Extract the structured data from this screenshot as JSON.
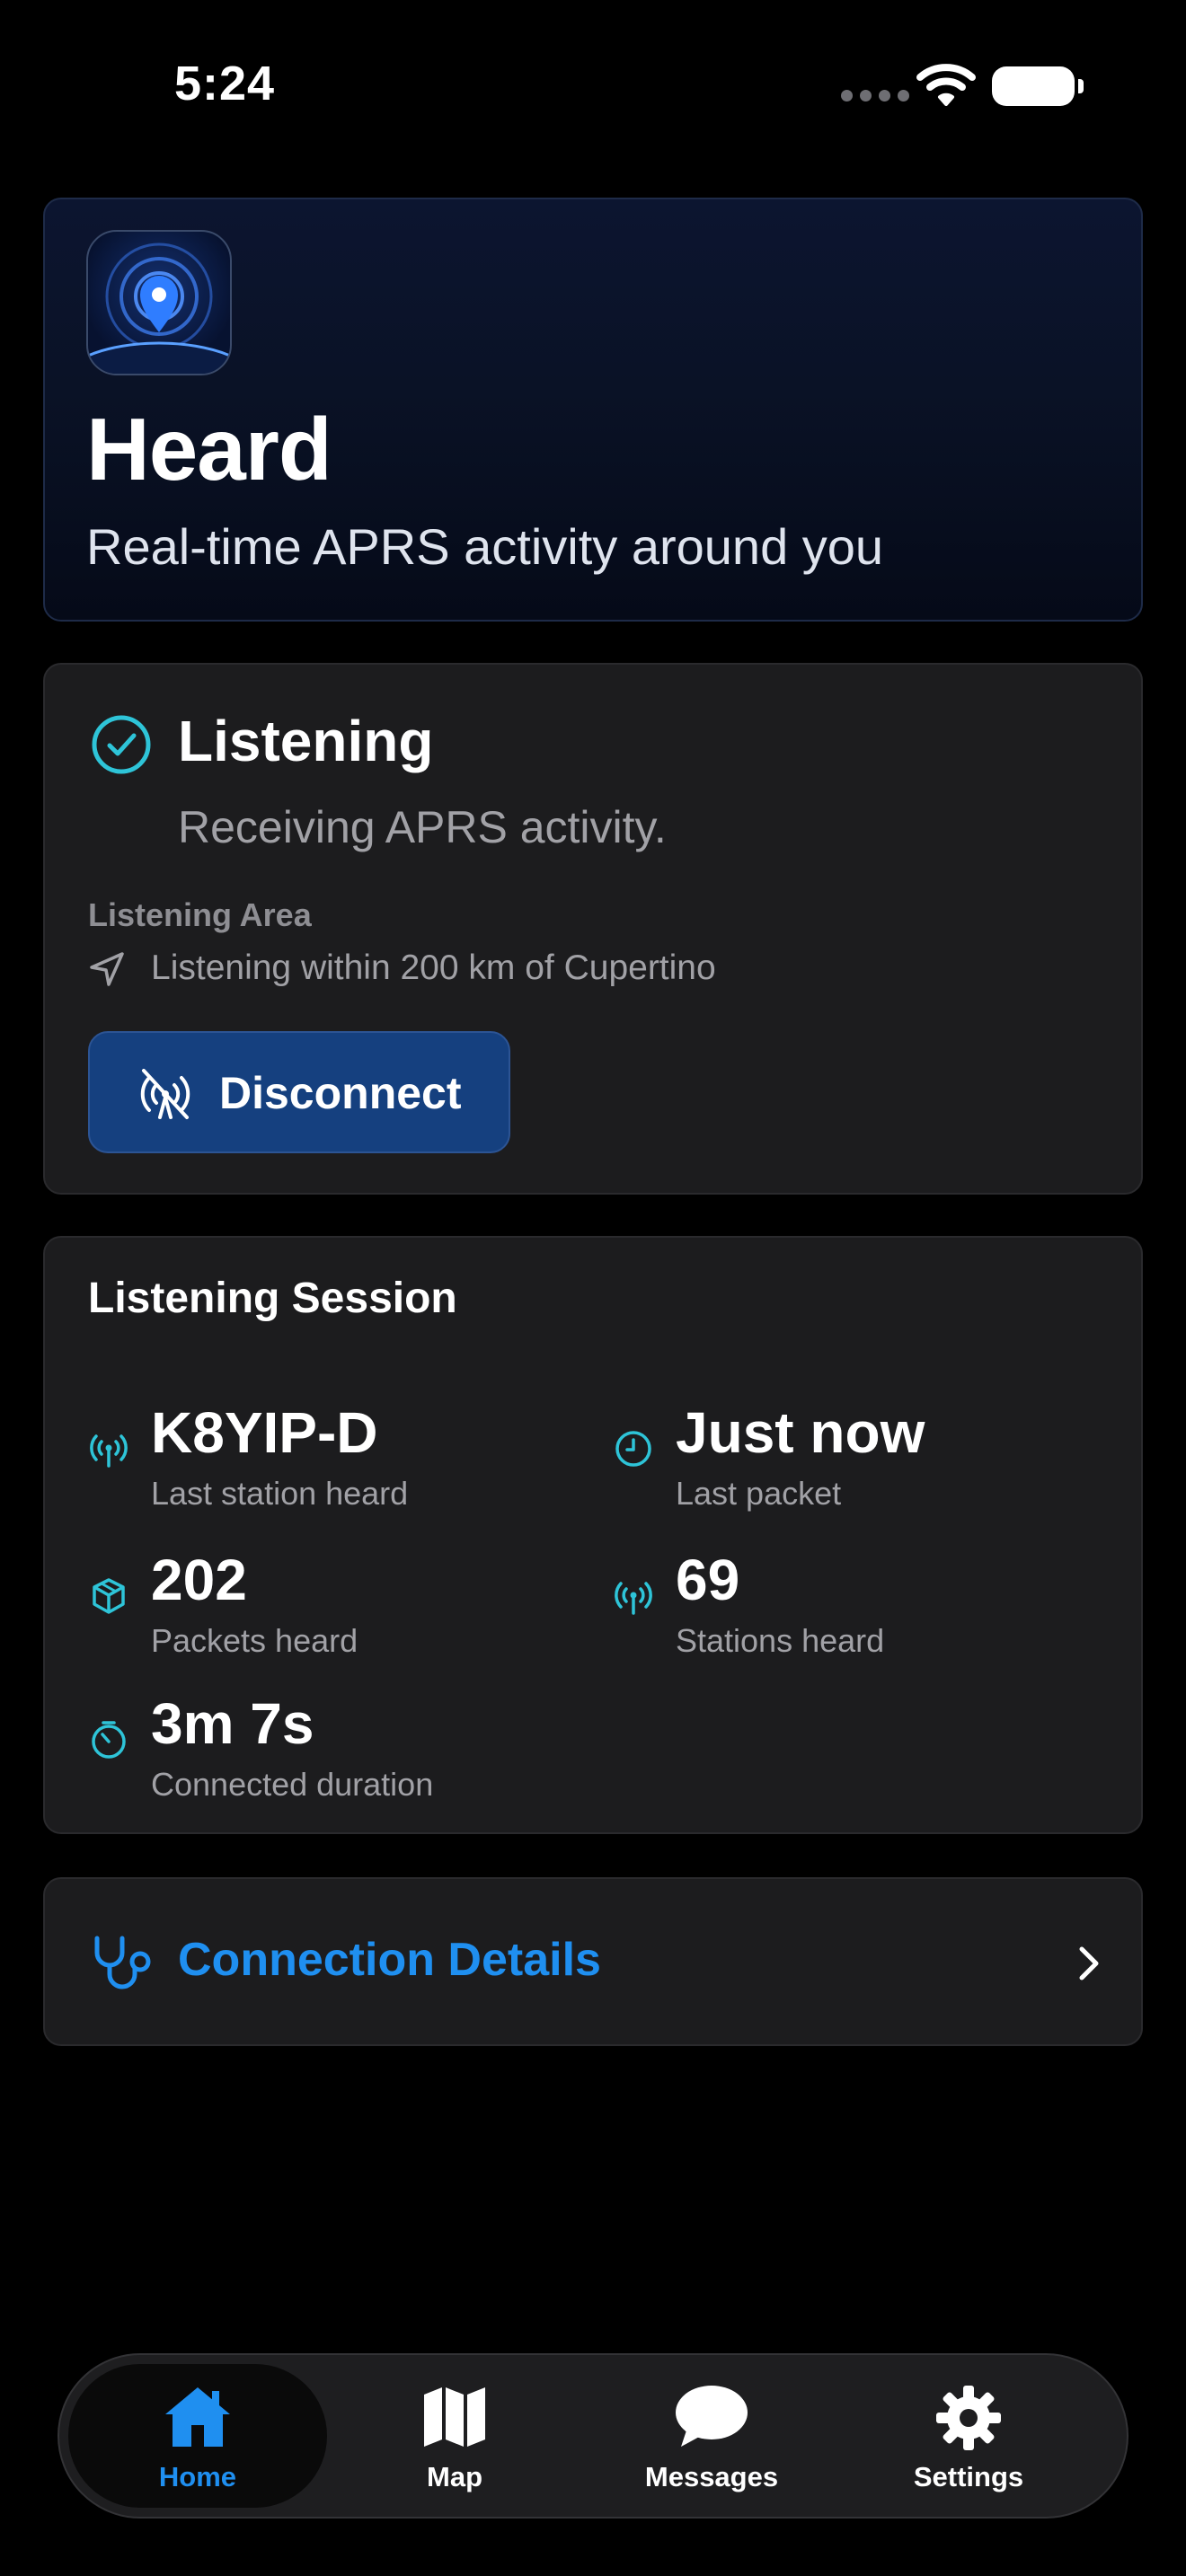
{
  "status_bar": {
    "time": "5:24"
  },
  "hero": {
    "title": "Heard",
    "subtitle": "Real-time APRS activity around you"
  },
  "listening": {
    "title": "Listening",
    "subtitle": "Receiving APRS activity.",
    "area_label": "Listening Area",
    "area_text": "Listening within 200 km of Cupertino",
    "disconnect_label": "Disconnect"
  },
  "session": {
    "title": "Listening Session",
    "stats": [
      {
        "value": "K8YIP-D",
        "label": "Last station heard",
        "icon": "antenna-icon"
      },
      {
        "value": "Just now",
        "label": "Last packet",
        "icon": "clock-icon"
      },
      {
        "value": "202",
        "label": "Packets heard",
        "icon": "cube-icon"
      },
      {
        "value": "69",
        "label": "Stations heard",
        "icon": "antenna-icon"
      },
      {
        "value": "3m 7s",
        "label": "Connected duration",
        "icon": "timer-icon"
      }
    ]
  },
  "details": {
    "label": "Connection Details"
  },
  "tabs": [
    {
      "label": "Home",
      "icon": "house-icon",
      "active": true
    },
    {
      "label": "Map",
      "icon": "map-icon",
      "active": false
    },
    {
      "label": "Messages",
      "icon": "chat-bubble-icon",
      "active": false
    },
    {
      "label": "Settings",
      "icon": "gear-icon",
      "active": false
    }
  ],
  "colors": {
    "accent": "#1f8ff0",
    "teal": "#2ec4d8",
    "card": "#1c1c1e",
    "disconnect": "#15407f"
  }
}
